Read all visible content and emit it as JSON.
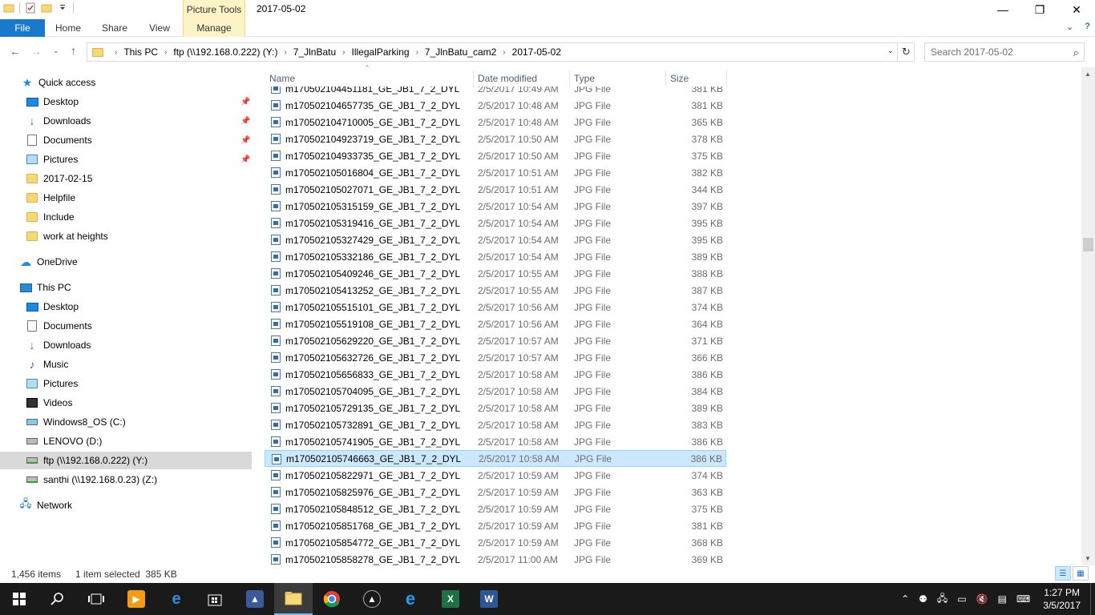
{
  "window": {
    "title": "2017-05-02",
    "context_tab": "Picture Tools",
    "minimize": "—",
    "maximize": "❐",
    "close": "✕"
  },
  "ribbon": {
    "tabs": [
      {
        "label": "File"
      },
      {
        "label": "Home"
      },
      {
        "label": "Share"
      },
      {
        "label": "View"
      },
      {
        "label": "Manage"
      }
    ],
    "expand": "⌄",
    "help": "?"
  },
  "address": {
    "crumbs": [
      "This PC",
      "ftp (\\\\192.168.0.222) (Y:)",
      "7_JlnBatu",
      "IllegalParking",
      "7_JlnBatu_cam2",
      "2017-05-02"
    ],
    "search_placeholder": "Search 2017-05-02"
  },
  "navpane": {
    "quick_access": "Quick access",
    "qa_items": [
      {
        "label": "Desktop",
        "icon": "desktop-icon"
      },
      {
        "label": "Downloads",
        "icon": "downloads-icon"
      },
      {
        "label": "Documents",
        "icon": "documents-icon"
      },
      {
        "label": "Pictures",
        "icon": "pictures-icon"
      },
      {
        "label": "2017-02-15",
        "icon": "folder-icon"
      },
      {
        "label": "Helpfile",
        "icon": "folder-icon"
      },
      {
        "label": "Include",
        "icon": "folder-icon"
      },
      {
        "label": "work at heights",
        "icon": "folder-icon"
      }
    ],
    "onedrive": "OneDrive",
    "this_pc": "This PC",
    "pc_items": [
      {
        "label": "Desktop"
      },
      {
        "label": "Documents"
      },
      {
        "label": "Downloads"
      },
      {
        "label": "Music"
      },
      {
        "label": "Pictures"
      },
      {
        "label": "Videos"
      },
      {
        "label": "Windows8_OS (C:)"
      },
      {
        "label": "LENOVO (D:)"
      },
      {
        "label": "ftp (\\\\192.168.0.222) (Y:)"
      },
      {
        "label": "santhi (\\\\192.168.0.23) (Z:)"
      }
    ],
    "network": "Network"
  },
  "columns": {
    "name": "Name",
    "date": "Date modified",
    "type": "Type",
    "size": "Size"
  },
  "files": [
    {
      "name": "m170502104451181_GE_JB1_7_2_DYL",
      "date": "2/5/2017 10:49 AM",
      "type": "JPG File",
      "size": "381 KB"
    },
    {
      "name": "m170502104657735_GE_JB1_7_2_DYL",
      "date": "2/5/2017 10:48 AM",
      "type": "JPG File",
      "size": "381 KB"
    },
    {
      "name": "m170502104710005_GE_JB1_7_2_DYL",
      "date": "2/5/2017 10:48 AM",
      "type": "JPG File",
      "size": "365 KB"
    },
    {
      "name": "m170502104923719_GE_JB1_7_2_DYL",
      "date": "2/5/2017 10:50 AM",
      "type": "JPG File",
      "size": "378 KB"
    },
    {
      "name": "m170502104933735_GE_JB1_7_2_DYL",
      "date": "2/5/2017 10:50 AM",
      "type": "JPG File",
      "size": "375 KB"
    },
    {
      "name": "m170502105016804_GE_JB1_7_2_DYL",
      "date": "2/5/2017 10:51 AM",
      "type": "JPG File",
      "size": "382 KB"
    },
    {
      "name": "m170502105027071_GE_JB1_7_2_DYL",
      "date": "2/5/2017 10:51 AM",
      "type": "JPG File",
      "size": "344 KB"
    },
    {
      "name": "m170502105315159_GE_JB1_7_2_DYL",
      "date": "2/5/2017 10:54 AM",
      "type": "JPG File",
      "size": "397 KB"
    },
    {
      "name": "m170502105319416_GE_JB1_7_2_DYL",
      "date": "2/5/2017 10:54 AM",
      "type": "JPG File",
      "size": "395 KB"
    },
    {
      "name": "m170502105327429_GE_JB1_7_2_DYL",
      "date": "2/5/2017 10:54 AM",
      "type": "JPG File",
      "size": "395 KB"
    },
    {
      "name": "m170502105332186_GE_JB1_7_2_DYL",
      "date": "2/5/2017 10:54 AM",
      "type": "JPG File",
      "size": "389 KB"
    },
    {
      "name": "m170502105409246_GE_JB1_7_2_DYL",
      "date": "2/5/2017 10:55 AM",
      "type": "JPG File",
      "size": "388 KB"
    },
    {
      "name": "m170502105413252_GE_JB1_7_2_DYL",
      "date": "2/5/2017 10:55 AM",
      "type": "JPG File",
      "size": "387 KB"
    },
    {
      "name": "m170502105515101_GE_JB1_7_2_DYL",
      "date": "2/5/2017 10:56 AM",
      "type": "JPG File",
      "size": "374 KB"
    },
    {
      "name": "m170502105519108_GE_JB1_7_2_DYL",
      "date": "2/5/2017 10:56 AM",
      "type": "JPG File",
      "size": "364 KB"
    },
    {
      "name": "m170502105629220_GE_JB1_7_2_DYL",
      "date": "2/5/2017 10:57 AM",
      "type": "JPG File",
      "size": "371 KB"
    },
    {
      "name": "m170502105632726_GE_JB1_7_2_DYL",
      "date": "2/5/2017 10:57 AM",
      "type": "JPG File",
      "size": "366 KB"
    },
    {
      "name": "m170502105656833_GE_JB1_7_2_DYL",
      "date": "2/5/2017 10:58 AM",
      "type": "JPG File",
      "size": "386 KB"
    },
    {
      "name": "m170502105704095_GE_JB1_7_2_DYL",
      "date": "2/5/2017 10:58 AM",
      "type": "JPG File",
      "size": "384 KB"
    },
    {
      "name": "m170502105729135_GE_JB1_7_2_DYL",
      "date": "2/5/2017 10:58 AM",
      "type": "JPG File",
      "size": "389 KB"
    },
    {
      "name": "m170502105732891_GE_JB1_7_2_DYL",
      "date": "2/5/2017 10:58 AM",
      "type": "JPG File",
      "size": "383 KB"
    },
    {
      "name": "m170502105741905_GE_JB1_7_2_DYL",
      "date": "2/5/2017 10:58 AM",
      "type": "JPG File",
      "size": "386 KB"
    },
    {
      "name": "m170502105746663_GE_JB1_7_2_DYL",
      "date": "2/5/2017 10:58 AM",
      "type": "JPG File",
      "size": "386 KB",
      "selected": true
    },
    {
      "name": "m170502105822971_GE_JB1_7_2_DYL",
      "date": "2/5/2017 10:59 AM",
      "type": "JPG File",
      "size": "374 KB"
    },
    {
      "name": "m170502105825976_GE_JB1_7_2_DYL",
      "date": "2/5/2017 10:59 AM",
      "type": "JPG File",
      "size": "363 KB"
    },
    {
      "name": "m170502105848512_GE_JB1_7_2_DYL",
      "date": "2/5/2017 10:59 AM",
      "type": "JPG File",
      "size": "375 KB"
    },
    {
      "name": "m170502105851768_GE_JB1_7_2_DYL",
      "date": "2/5/2017 10:59 AM",
      "type": "JPG File",
      "size": "381 KB"
    },
    {
      "name": "m170502105854772_GE_JB1_7_2_DYL",
      "date": "2/5/2017 10:59 AM",
      "type": "JPG File",
      "size": "368 KB"
    },
    {
      "name": "m170502105858278_GE_JB1_7_2_DYL",
      "date": "2/5/2017 11:00 AM",
      "type": "JPG File",
      "size": "369 KB"
    }
  ],
  "status": {
    "item_count": "1,456 items",
    "selection": "1 item selected  385 KB"
  },
  "taskbar": {
    "apps": [
      {
        "name": "start-button",
        "icon": "windows-icon"
      },
      {
        "name": "search-button",
        "icon": "search-icon"
      },
      {
        "name": "task-view-button",
        "icon": "task-view-icon"
      },
      {
        "name": "media-player-app",
        "icon": "media-player-icon"
      },
      {
        "name": "edge-app",
        "icon": "edge-icon"
      },
      {
        "name": "store-app",
        "icon": "store-icon"
      },
      {
        "name": "app-6",
        "icon": "app-icon"
      },
      {
        "name": "file-explorer-app",
        "icon": "folder-icon"
      },
      {
        "name": "chrome-app",
        "icon": "chrome-icon"
      },
      {
        "name": "app-9",
        "icon": "app-icon"
      },
      {
        "name": "ie-app",
        "icon": "ie-icon"
      },
      {
        "name": "excel-app",
        "icon": "excel-icon"
      },
      {
        "name": "word-app",
        "icon": "word-icon"
      }
    ],
    "time": "1:27 PM",
    "date": "3/5/2017"
  },
  "colors": {
    "file_tab": "#1979ca",
    "context_tab": "#fcf3c6",
    "selection": "#cce8ff",
    "taskbar": "#1a1a1a"
  }
}
